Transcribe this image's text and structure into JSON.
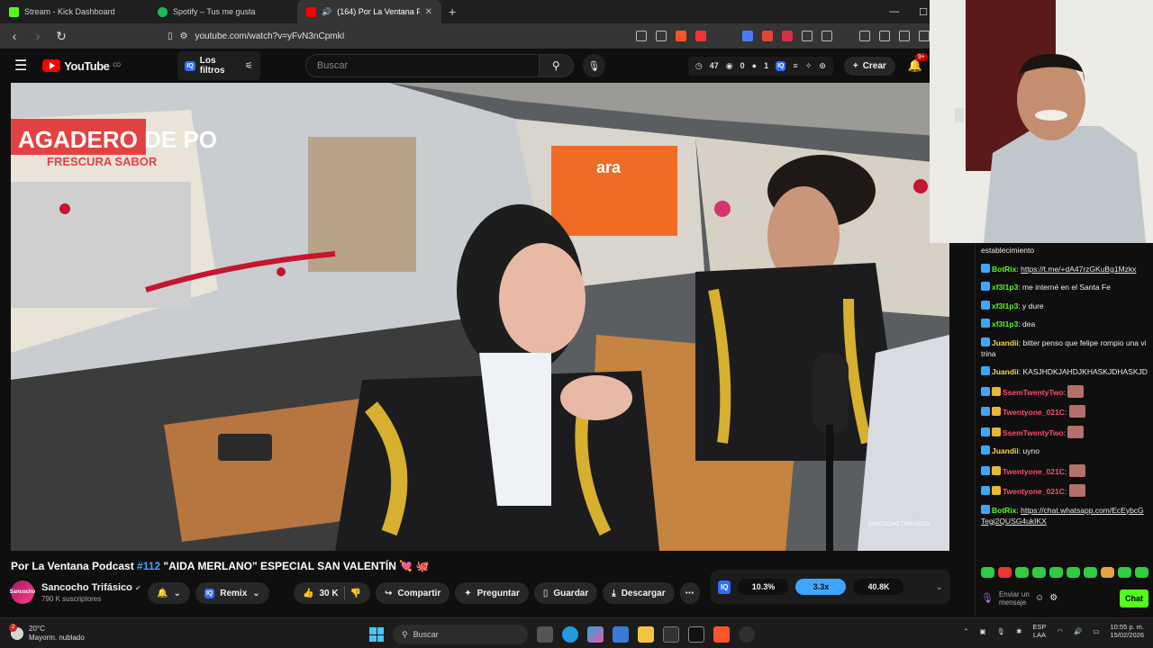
{
  "browser": {
    "tabs": [
      {
        "title": "Stream - Kick Dashboard",
        "color": "#53fc18",
        "active": false
      },
      {
        "title": "Spotify – Tus me gusta",
        "color": "#1db954",
        "active": false
      },
      {
        "title": "(164) Por La Ventana Podcast",
        "color": "#ff0000",
        "active": true
      }
    ],
    "url": "youtube.com/watch?v=yFvN3nCpmkI"
  },
  "yt": {
    "logo": "YouTube",
    "logo_sup": "CO",
    "filters_label": "Los filtros",
    "iq": "IQ",
    "search_placeholder": "Buscar",
    "stats": {
      "views": "47",
      "a": "0",
      "b": "1"
    },
    "create_label": "Crear",
    "notif_badge": "9+"
  },
  "video": {
    "title_prefix": "Por La Ventana Podcast ",
    "title_number": "#112",
    "title_rest": " \"AIDA MERLANO\" ESPECIAL SAN VALENTÍN 💘 🐙",
    "channel_name": "Sancocho Trifásico",
    "channel_avatar_text": "Sancocho",
    "subscribers": "790 K suscriptores",
    "remix_label": "Remix",
    "like_count": "30 K",
    "share_label": "Compartir",
    "ask_label": "Preguntar",
    "save_label": "Guardar",
    "download_label": "Descargar",
    "iq_stats": [
      "10.3%",
      "3.3x",
      "40.8K"
    ],
    "watermark": "SANCOCHO TRIFÁSICO",
    "sign_text": "AGADERO DE PO",
    "sign_sub": "FRESCURA SABOR",
    "store_text": "ara"
  },
  "chat": {
    "messages": [
      {
        "user": "",
        "text": "establecimiento",
        "color": "#eeeeee"
      },
      {
        "user": "BotRix",
        "text": "https://t.me/+dA47rzGKuBg1Mzkx",
        "color": "#53fc18",
        "link": true
      },
      {
        "user": "xf3l1p3",
        "text": "me interné en el Santa Fe",
        "color": "#53fc18"
      },
      {
        "user": "xf3l1p3",
        "text": "y dure",
        "color": "#53fc18"
      },
      {
        "user": "xf3l1p3",
        "text": "dea",
        "color": "#53fc18"
      },
      {
        "user": "Juandii",
        "text": "bitter penso que felipe rompio una vitrina",
        "color": "#f5d742"
      },
      {
        "user": "Juandii",
        "text": "KASJHDKJAHDJKHASKJDHASKJD",
        "color": "#f5d742"
      },
      {
        "user": "SsemTwentyTwo",
        "text": "",
        "color": "#ff4d6a",
        "emote": true
      },
      {
        "user": "Twentyone_021C",
        "text": "",
        "color": "#ff4d6a",
        "emote": true
      },
      {
        "user": "SsemTwentyTwo",
        "text": "",
        "color": "#ff4d6a",
        "emote": true
      },
      {
        "user": "Juandii",
        "text": "uyno",
        "color": "#f5d742"
      },
      {
        "user": "Twentyone_021C",
        "text": "",
        "color": "#ff4d6a",
        "emote": true
      },
      {
        "user": "Twentyone_021C",
        "text": "",
        "color": "#ff4d6a",
        "emote": true
      },
      {
        "user": "BotRix",
        "text": "https://chat.whatsapp.com/EcEybcGTegj2QUSG4ukIKX",
        "color": "#53fc18",
        "link": true
      }
    ],
    "input_placeholder": "Enviar un mensaje",
    "send_label": "Chat"
  },
  "taskbar": {
    "temp": "20°C",
    "weather": "Mayorm. nublado",
    "weather_badge": "2",
    "search": "Buscar",
    "lang_top": "ESP",
    "lang_bottom": "LAA",
    "time": "10:55 p. m.",
    "date": "15/02/2026"
  }
}
